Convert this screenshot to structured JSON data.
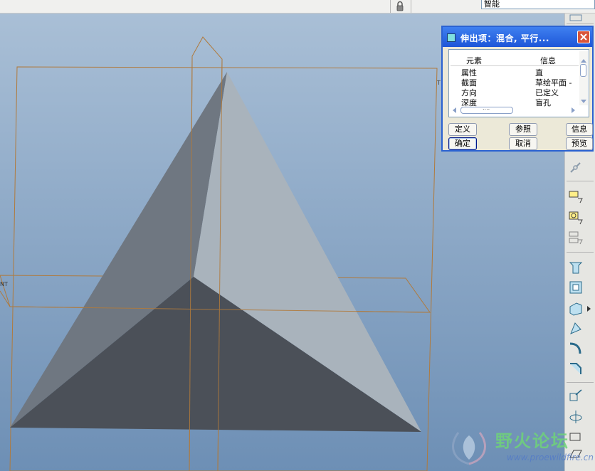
{
  "topbar": {
    "smart_filter_value": "智能"
  },
  "viewport": {
    "datum_label_top": "T",
    "datum_label_left": "NT"
  },
  "dialog": {
    "title": "伸出项：混合, 平行...",
    "table": {
      "columns": [
        "元素",
        "信息"
      ],
      "rows": [
        {
          "element": "属性",
          "info": "直"
        },
        {
          "element": "截面",
          "info": "草绘平面 -"
        },
        {
          "element": "方向",
          "info": "已定义"
        },
        {
          "element": "深度",
          "info": "盲孔"
        }
      ],
      "hscroll_thumb_label": "...."
    },
    "buttons": {
      "define": "定义",
      "refs": "参照",
      "info": "信息",
      "ok": "确定",
      "cancel": "取消",
      "preview": "预览"
    }
  },
  "watermark": {
    "text": "野火论坛",
    "url": "www.proewildfire.cn"
  },
  "colors": {
    "viewport_top": "#a9bfd6",
    "viewport_bottom": "#6d8fb5",
    "datum_plane": "#b07a3c",
    "titlebar": "#2b62d1",
    "face_left": "#6f7781",
    "face_right": "#a9b3bc",
    "face_bottom": "#4b5058"
  }
}
